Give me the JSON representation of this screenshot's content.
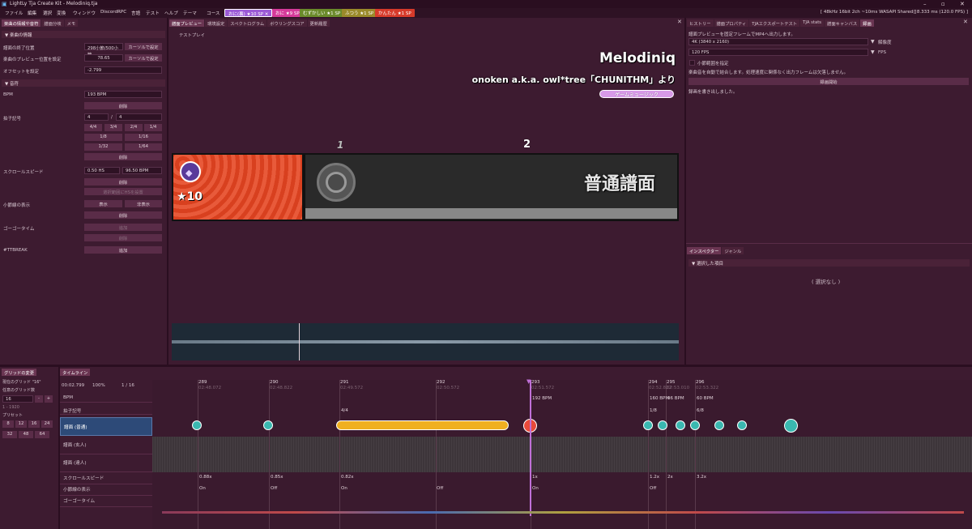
{
  "window": {
    "title": "LightLy Tja Create Kit - Melodiniq.tja"
  },
  "menu": [
    "ファイル",
    "編集",
    "選択",
    "変換",
    "ウィンドウ",
    "DiscordRPC",
    "言語",
    "テスト",
    "ヘルプ",
    "テーマ",
    "コース"
  ],
  "course_tabs": [
    {
      "label": "おに(裏) ★10 SP",
      "color": "#9b5ad6"
    },
    {
      "label": "おに ★9 SP",
      "color": "#d63a9a"
    },
    {
      "label": "むずかしい ★1 SP",
      "color": "#6a8a2a"
    },
    {
      "label": "ふつう ★1 SP",
      "color": "#9a8a2a"
    },
    {
      "label": "かんたん ★1 SP",
      "color": "#d63a2a"
    }
  ],
  "status": {
    "audio": "[ 48kHz 16bit 2ch ~10ms WASAPI Shared ]",
    "fps": "[ 8.333 ms (120.0 FPS) ]"
  },
  "left_tabs": [
    "楽曲の情報や音符",
    "譜面分岐",
    "メモ"
  ],
  "song_info": {
    "header": "楽曲の情報",
    "end_label": "譜面の終了位置",
    "end_value": "298小節/500小節",
    "end_btn": "カーソルで設定",
    "preview_label": "楽曲のプレビュー位置を設定",
    "preview_value": "78.65",
    "preview_btn": "カーソルで設定",
    "offset_label": "オフセットを設定",
    "offset_value": "-2.799"
  },
  "notes_sec": {
    "header": "音符",
    "bpm_label": "BPM",
    "bpm_value": "193 BPM",
    "delete": "削除",
    "meter_label": "拍子記号",
    "meter_num": "4",
    "meter_slash": "/",
    "meter_den": "4",
    "meter_presets": [
      "4/4",
      "3/4",
      "2/4",
      "1/4",
      "1/8",
      "1/16",
      "1/32",
      "1/64"
    ],
    "scroll_label": "スクロールスピード",
    "scroll_value": "0.50 HS",
    "scroll_bpm": "96.50 BPM",
    "scroll_reset": "選択範囲にHSを設置",
    "barline_label": "小節線の表示",
    "show": "表示",
    "hide": "非表示",
    "gogo_label": "ゴーゴータイム",
    "gogo_btn1": "追加",
    "gogo_btn2": "削除",
    "ttbreak_label": "#TTBREAK",
    "ttbreak_btn": "追加"
  },
  "center_tabs": [
    "譜面プレビュー",
    "環境設定",
    "スペクトログラム",
    "ボウリングスコア",
    "更新履歴"
  ],
  "test_play": "テストプレイ",
  "preview": {
    "title": "Melodiniq",
    "subtitle": "onoken a.k.a. owl*tree「CHUNITHM」より",
    "genre": "ゲームミュージック",
    "measure1": "1",
    "measure2": "2",
    "difficulty": "普通譜面",
    "stars": "★10"
  },
  "right_tabs": [
    "ヒストリー",
    "譜面プロパティ",
    "TJAエクスポートテスト",
    "TJA stats",
    "譜面キャンバス",
    "録画"
  ],
  "record": {
    "desc": "譜面プレビューを固定フレームでMP4へ出力します。",
    "res": "4K (3840 x 2160)",
    "res_lbl": "解像度",
    "fps": "120 FPS",
    "fps_lbl": "FPS",
    "range": "小節範囲を指定",
    "note": "楽曲音を自動で結合します。処理速度に関係なく出力フレームは欠落しません。",
    "start": "録画開始",
    "done": "録画を書き出しました。"
  },
  "inspector": {
    "tabs": [
      "インスペクター",
      "ジャンル"
    ],
    "header": "選択した項目",
    "empty": "( 選択なし )"
  },
  "grid": {
    "tab": "グリッドの変更",
    "current": "現在のグリッド \"16\"",
    "any_label": "任意のグリッド数",
    "any_value": "16",
    "minus": "-",
    "plus": "+",
    "range": "1 - 1920",
    "presets_label": "プリセット",
    "presets": [
      "8",
      "12",
      "16",
      "24",
      "32",
      "48",
      "64"
    ]
  },
  "timeline": {
    "tab": "タイムライン",
    "time": "00:02.799",
    "zoom": "100%",
    "grid": "1 / 16",
    "rows": [
      "BPM",
      "拍子記号",
      "譜面 (普通)",
      "譜面 (玄人)",
      "譜面 (達人)",
      "スクロールスピード",
      "小節線の表示",
      "ゴーゴータイム"
    ],
    "measures": [
      {
        "n": "289",
        "t": "02:48.072"
      },
      {
        "n": "290",
        "t": "02:48.822"
      },
      {
        "n": "291",
        "t": "02:49.572"
      },
      {
        "n": "292",
        "t": "02:50.572"
      },
      {
        "n": "293",
        "t": "02:51.572"
      },
      {
        "n": "294",
        "t": "02:52.822"
      },
      {
        "n": "295",
        "t": "02:53.010"
      },
      {
        "n": "296",
        "t": "02:53.322"
      }
    ],
    "bpm_marks": [
      "192 BPM",
      "160 BPM",
      "96 BPM",
      "60 BPM"
    ],
    "meter_marks": [
      "4/4",
      "1/8",
      "6/8"
    ],
    "scroll_marks": [
      "0.88x",
      "0.85x",
      "0.82x",
      "1x",
      "1.2x",
      "2x",
      "3.2x"
    ],
    "barline_marks": [
      "On",
      "Off",
      "On",
      "Off",
      "On",
      "Off"
    ]
  }
}
